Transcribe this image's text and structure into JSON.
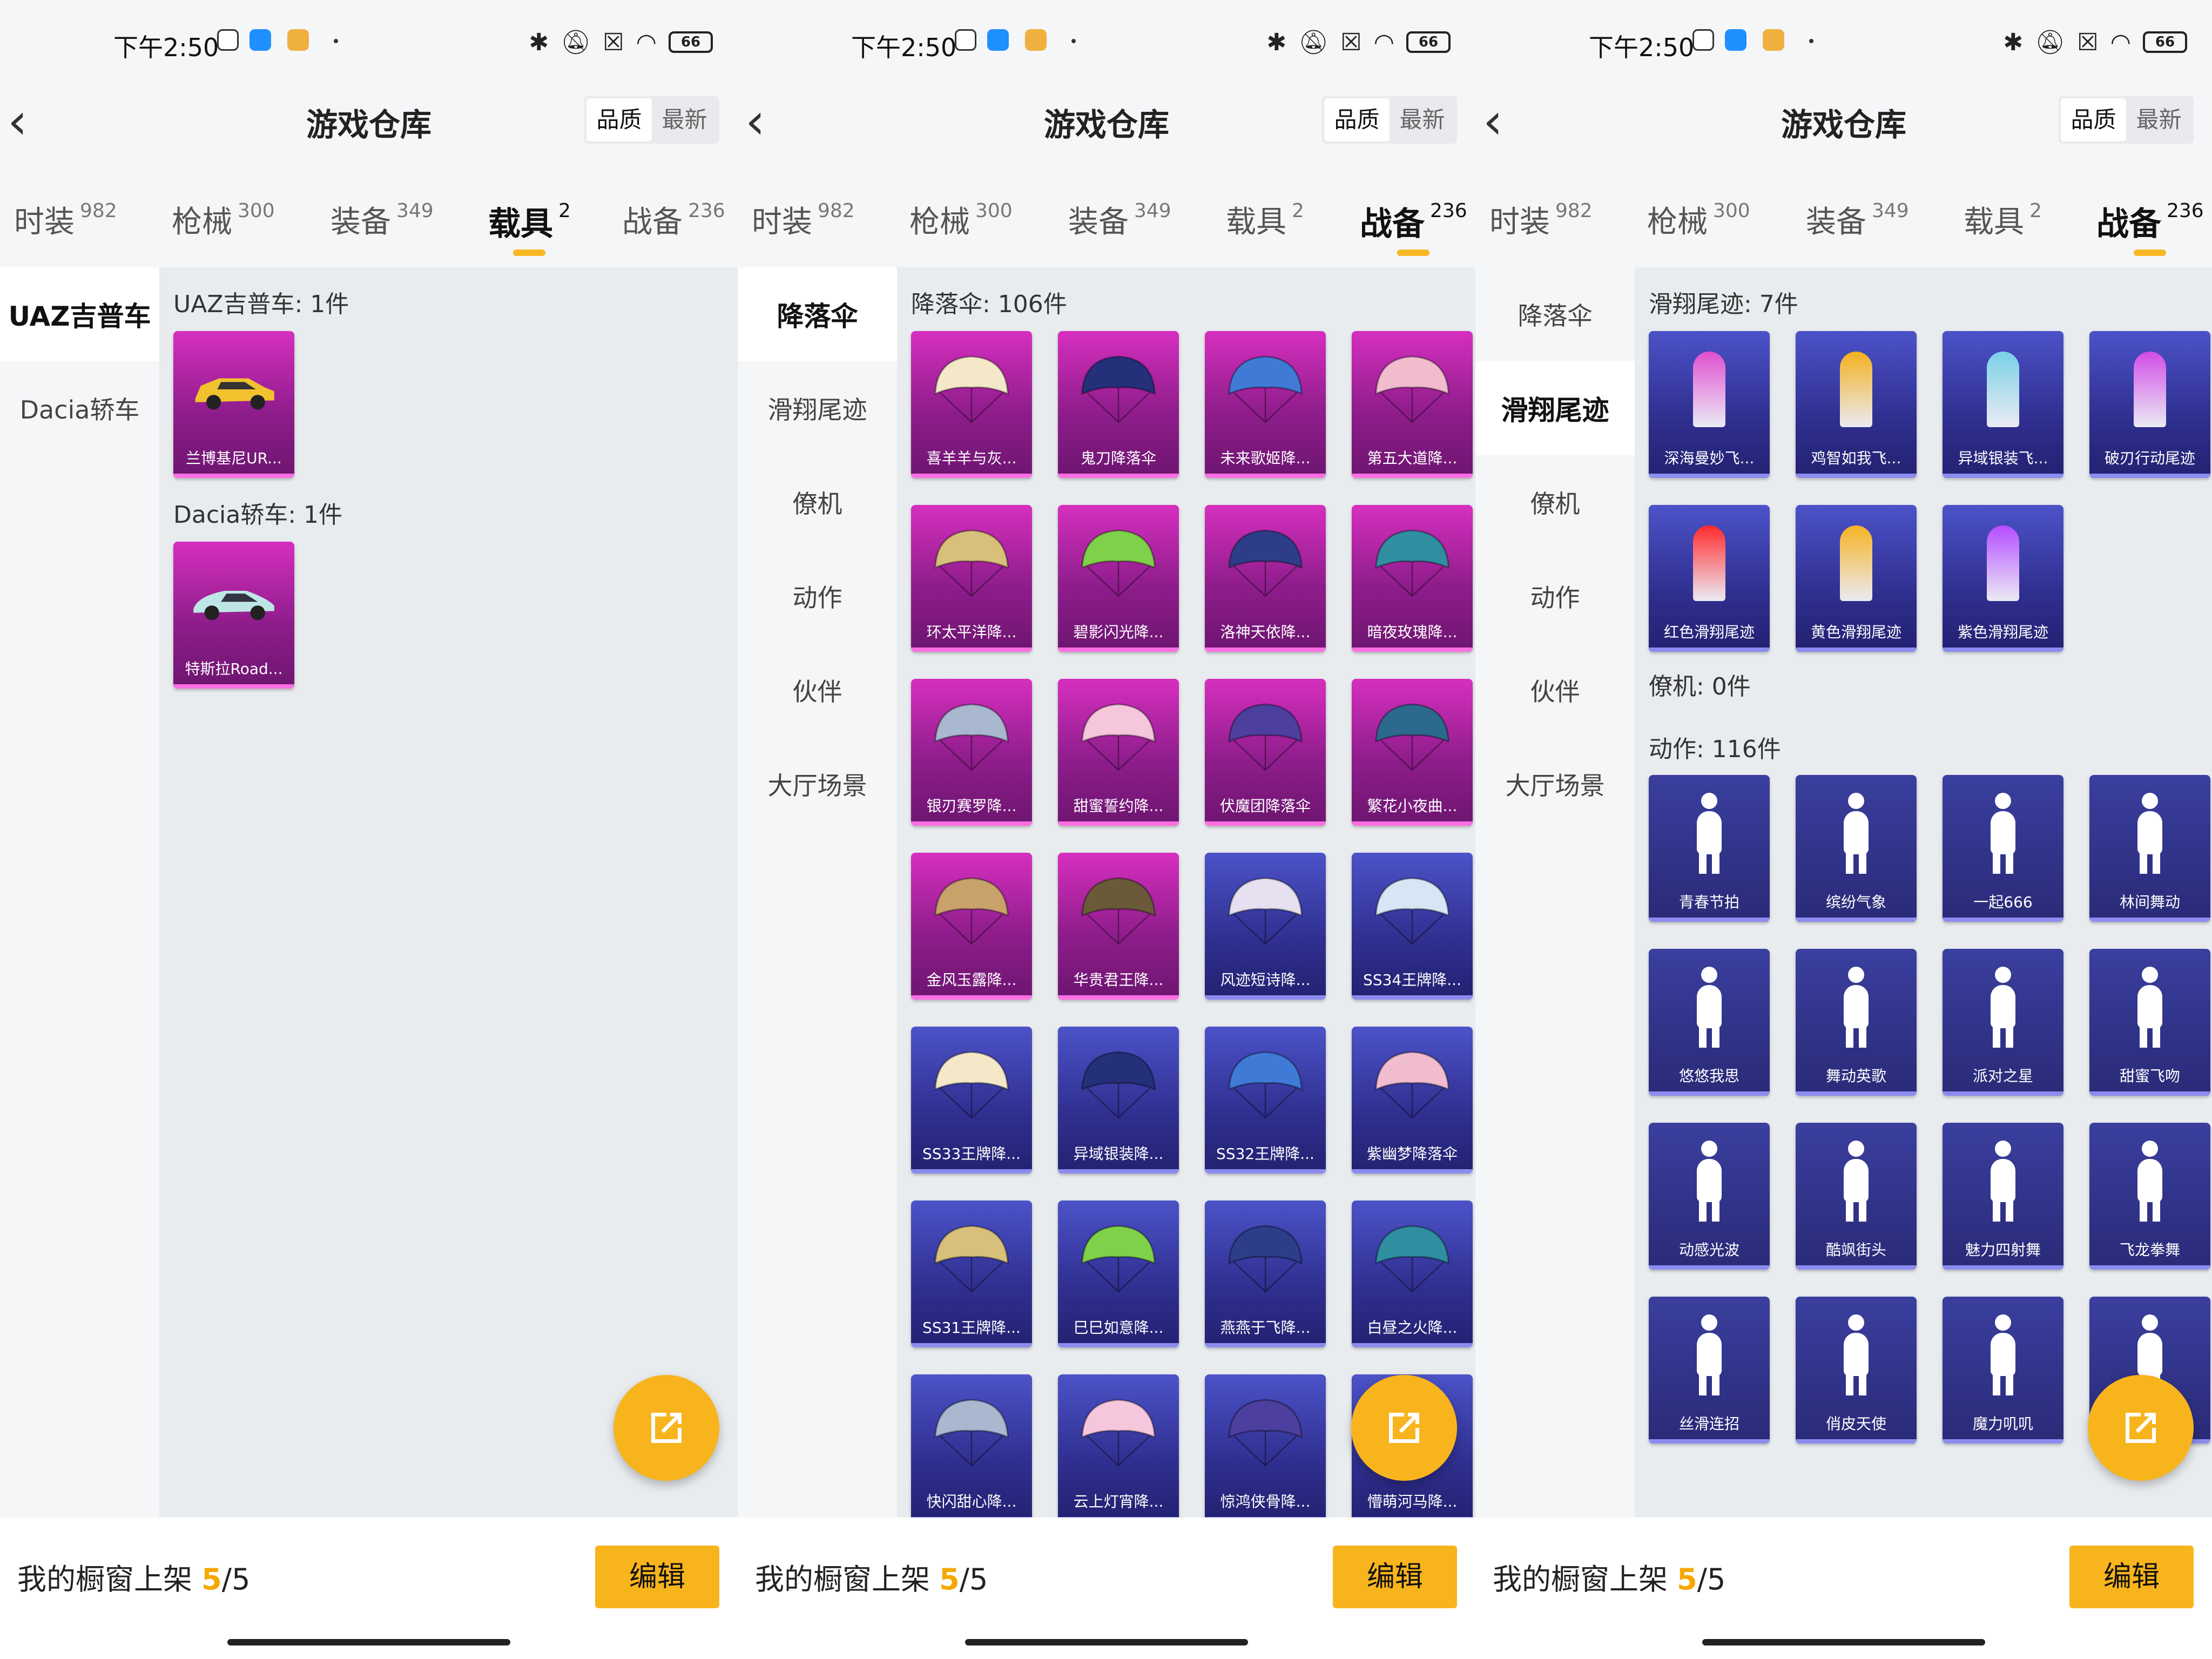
{
  "status": {
    "time": "下午2:50",
    "battery": "66"
  },
  "header": {
    "title": "游戏仓库",
    "sort_quality": "品质",
    "sort_latest": "最新"
  },
  "tabs": [
    {
      "label": "时装",
      "count": "982"
    },
    {
      "label": "枪械",
      "count": "300"
    },
    {
      "label": "装备",
      "count": "349"
    },
    {
      "label": "载具",
      "count": "2"
    },
    {
      "label": "战备",
      "count": "236"
    }
  ],
  "sidebars": {
    "vehicle": [
      "UAZ吉普车",
      "Dacia轿车"
    ],
    "gear": [
      "降落伞",
      "滑翔尾迹",
      "僚机",
      "动作",
      "伙伴",
      "大厅场景"
    ]
  },
  "panel1": {
    "sec_uaz": "UAZ吉普车: 1件",
    "sec_dacia": "Dacia轿车: 1件",
    "items": [
      "兰博基尼UR...",
      "特斯拉Road..."
    ]
  },
  "panel2": {
    "sec_parachute": "降落伞: 106件",
    "items": [
      "喜羊羊与灰...",
      "鬼刀降落伞",
      "未来歌姬降...",
      "第五大道降...",
      "环太平洋降...",
      "碧影闪光降...",
      "洛神天依降...",
      "暗夜玫瑰降...",
      "银刃赛罗降...",
      "甜蜜誓约降...",
      "伏魔团降落伞",
      "繁花小夜曲...",
      "金风玉露降...",
      "华贵君王降...",
      "风迹短诗降...",
      "SS34王牌降...",
      "SS33王牌降...",
      "异域银装降...",
      "SS32王牌降...",
      "紫幽梦降落伞",
      "SS31王牌降...",
      "巳巳如意降...",
      "燕燕于飞降...",
      "白昼之火降...",
      "快闪甜心降...",
      "云上灯宵降...",
      "惊鸿侠骨降...",
      "懵萌河马降..."
    ]
  },
  "panel3": {
    "sec_trail": "滑翔尾迹: 7件",
    "trail_items": [
      "深海曼妙飞...",
      "鸡智如我飞...",
      "异域银装飞...",
      "破刃行动尾迹",
      "红色滑翔尾迹",
      "黄色滑翔尾迹",
      "紫色滑翔尾迹"
    ],
    "sec_wingman": "僚机: 0件",
    "sec_emote": "动作: 116件",
    "emote_items": [
      "青春节拍",
      "缤纷气象",
      "一起666",
      "林间舞动",
      "悠悠我思",
      "舞动英歌",
      "派对之星",
      "甜蜜飞吻",
      "动感光波",
      "酷飒街头",
      "魅力四射舞",
      "飞龙拳舞",
      "丝滑连招",
      "俏皮天使",
      "魔力叽叽",
      ""
    ]
  },
  "bottom": {
    "label": "我的橱窗上架",
    "count_num": "5",
    "count_total": "/5",
    "edit": "编辑"
  },
  "colors": {
    "accent": "#f8b41c",
    "card_pink": "#b3249f",
    "card_blue": "#33338a"
  }
}
